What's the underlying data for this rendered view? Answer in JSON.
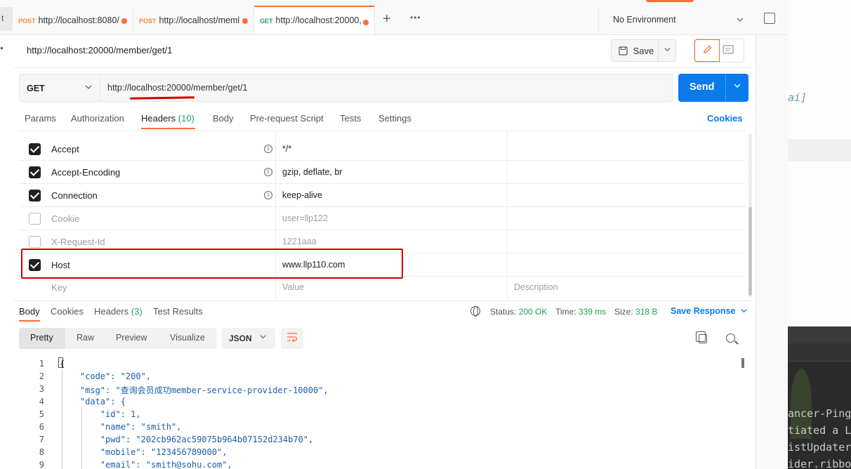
{
  "tabs": {
    "stub_label": "t",
    "items": [
      {
        "method": "POST",
        "url": "http://localhost:8080/"
      },
      {
        "method": "POST",
        "url": "http://localhost/meml"
      },
      {
        "method": "GET",
        "url": "http://localhost:20000,"
      }
    ],
    "plus": "+",
    "more": "•••"
  },
  "environment": {
    "label": "No Environment"
  },
  "request": {
    "title": "http://localhost:20000/member/get/1",
    "save_label": "Save",
    "method": "GET",
    "url": "http://localhost:20000/member/get/1",
    "send_label": "Send"
  },
  "request_tabs": [
    {
      "label": "Params"
    },
    {
      "label": "Authorization"
    },
    {
      "label": "Headers",
      "count": "(10)"
    },
    {
      "label": "Body"
    },
    {
      "label": "Pre-request Script"
    },
    {
      "label": "Tests"
    },
    {
      "label": "Settings"
    }
  ],
  "cookies_link": "Cookies",
  "headers": [
    {
      "key": "Accept",
      "value": "*/*",
      "checked": true
    },
    {
      "key": "Accept-Encoding",
      "value": "gzip, deflate, br",
      "checked": true
    },
    {
      "key": "Connection",
      "value": "keep-alive",
      "checked": true
    },
    {
      "key": "Cookie",
      "value": "user=llp122",
      "checked": false
    },
    {
      "key": "X-Request-Id",
      "value": "1221aaa",
      "checked": false
    },
    {
      "key": "Host",
      "value": "www.llp110.com",
      "checked": true
    }
  ],
  "headers_placeholder": {
    "key": "Key",
    "value": "Value",
    "description": "Description"
  },
  "response_tabs": [
    {
      "label": "Body"
    },
    {
      "label": "Cookies"
    },
    {
      "label": "Headers",
      "count": "(3)"
    },
    {
      "label": "Test Results"
    }
  ],
  "response_status": {
    "status_label": "Status:",
    "status_value": "200 OK",
    "time_label": "Time:",
    "time_value": "339 ms",
    "size_label": "Size:",
    "size_value": "318 B",
    "save_response": "Save Response"
  },
  "format_tabs": [
    "Pretty",
    "Raw",
    "Preview",
    "Visualize"
  ],
  "language": "JSON",
  "code_lines": [
    {
      "n": "1",
      "text": "{"
    },
    {
      "n": "2",
      "text": "    \"code\": \"200\","
    },
    {
      "n": "3",
      "text": "    \"msg\": \"查询会员成功member-service-provider-10000\","
    },
    {
      "n": "4",
      "text": "    \"data\": {"
    },
    {
      "n": "5",
      "text": "        \"id\": 1,"
    },
    {
      "n": "6",
      "text": "        \"name\": \"smith\","
    },
    {
      "n": "7",
      "text": "        \"pwd\": \"202cb962ac59075b964b07152d234b70\","
    },
    {
      "n": "8",
      "text": "        \"mobile\": \"123456789000\","
    },
    {
      "n": "9",
      "text": "        \"email\": \"smith@sohu.com\","
    }
  ],
  "ide": {
    "lines": [
      "ai]",
      "ancer-Pingl",
      "tiated a Lo",
      "istUpdater",
      "ider.ribbo"
    ]
  },
  "colors": {
    "accent": "#ff6c37",
    "send": "#097bed",
    "ok": "#1f9e5a",
    "annotation": "#d40000"
  }
}
